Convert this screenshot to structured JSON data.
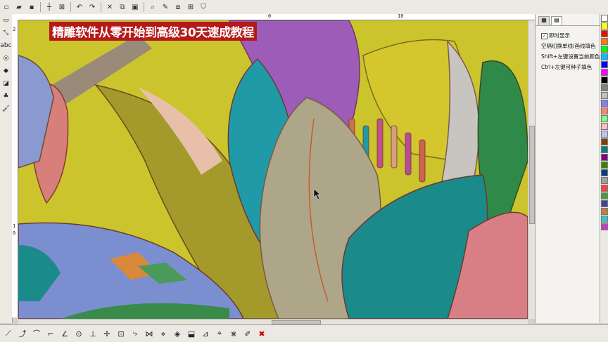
{
  "overlay_title": "精雕软件从零开始到高级30天速成教程",
  "ruler_top_marks": [
    "0",
    "10"
  ],
  "ruler_left_marks": [
    "2",
    "1",
    "0"
  ],
  "panel": {
    "checkbox_label": "即时显示",
    "checked": true,
    "help_lines": [
      "空隔切换单线/画线填色",
      "Shift+左键设置当前颜色",
      "Ctrl+左键可种子填色"
    ]
  },
  "palette_colors": [
    "#ffffff",
    "#ffff00",
    "#ff0000",
    "#ff8000",
    "#00ff00",
    "#00c0ff",
    "#0000ff",
    "#ff00ff",
    "#000000",
    "#808080",
    "#c0c0c0",
    "#8080ff",
    "#ff8080",
    "#80ff80",
    "#ffc0c0",
    "#c0c0ff",
    "#804000",
    "#008080",
    "#800080",
    "#408000",
    "#004080",
    "#a0a0a0",
    "#ff4040",
    "#40a040",
    "#4040a0",
    "#c08040",
    "#40c0c0",
    "#c040c0"
  ],
  "top_toolbar_icons": [
    "new-icon",
    "open-icon",
    "save-icon",
    "cross-icon",
    "box-icon",
    "undo-icon",
    "redo-icon",
    "cut-icon",
    "copy-icon",
    "paste-icon",
    "zoom-icon",
    "pen-icon",
    "layer-icon",
    "grid-icon",
    "shield-icon"
  ],
  "left_toolbar_icons": [
    "select-icon",
    "node-icon",
    "text-icon",
    "circle-icon",
    "fill-icon",
    "eraser-icon",
    "tree-icon",
    "brush-icon"
  ],
  "bottom_toolbar_icons": [
    "line-icon",
    "curve-icon",
    "arc-icon",
    "corner-icon",
    "angle-icon",
    "circle-node-icon",
    "trim-icon",
    "cross-icon",
    "point-icon",
    "bend-icon",
    "mirror-icon",
    "array-icon",
    "offset-icon",
    "paint-icon",
    "measure-icon",
    "snap-icon",
    "node-edit-icon",
    "pencil-icon",
    "delete-icon"
  ]
}
